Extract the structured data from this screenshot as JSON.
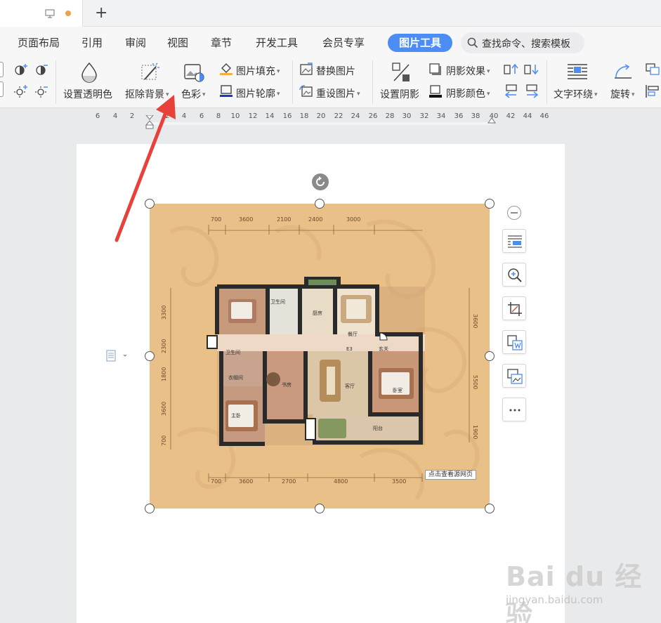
{
  "tabs": {
    "new_tab": "+"
  },
  "menu": {
    "items": [
      "页面布局",
      "引用",
      "审阅",
      "视图",
      "章节",
      "开发工具",
      "会员专享"
    ],
    "active": "图片工具",
    "search": "查找命令、搜索模板"
  },
  "ribbon": {
    "transparent": "设置透明色",
    "remove_bg": "抠除背景",
    "color": "色彩",
    "fill": "图片填充",
    "outline": "图片轮廓",
    "replace": "替换图片",
    "reset": "重设图片",
    "shadow": "设置阴影",
    "shadow_effect": "阴影效果",
    "shadow_color": "阴影颜色",
    "wrap": "文字环绕",
    "rotate": "旋转"
  },
  "ruler": {
    "ticks": [
      "6",
      "4",
      "2",
      "2",
      "4",
      "6",
      "8",
      "10",
      "12",
      "14",
      "16",
      "18",
      "20",
      "22",
      "24",
      "26",
      "28",
      "30",
      "32",
      "34",
      "36",
      "38",
      "40",
      "42",
      "44",
      "46"
    ]
  },
  "plan": {
    "dims_top": [
      "700",
      "3600",
      "2100",
      "2400",
      "3000"
    ],
    "dims_bottom": [
      "700",
      "3600",
      "2700",
      "4800",
      "3500"
    ],
    "dims_left": [
      "3300",
      "2300",
      "1800",
      "3600",
      "700"
    ],
    "dims_right": [
      "3600",
      "5500",
      "1900"
    ],
    "rooms": [
      "卫生间",
      "厨房",
      "餐厅",
      "卫生间",
      "玄关",
      "衣帽间",
      "书房",
      "客厅",
      "卧室",
      "主卧",
      "阳台",
      "E3"
    ],
    "source_link": "点击查看源网页"
  },
  "watermark": {
    "logo": "Bai du 经验",
    "url": "jingyan.baidu.com"
  },
  "colors": {
    "accent": "#4c8cf5",
    "arrow": "#e8413a",
    "plan_bg": "#e9c088"
  }
}
